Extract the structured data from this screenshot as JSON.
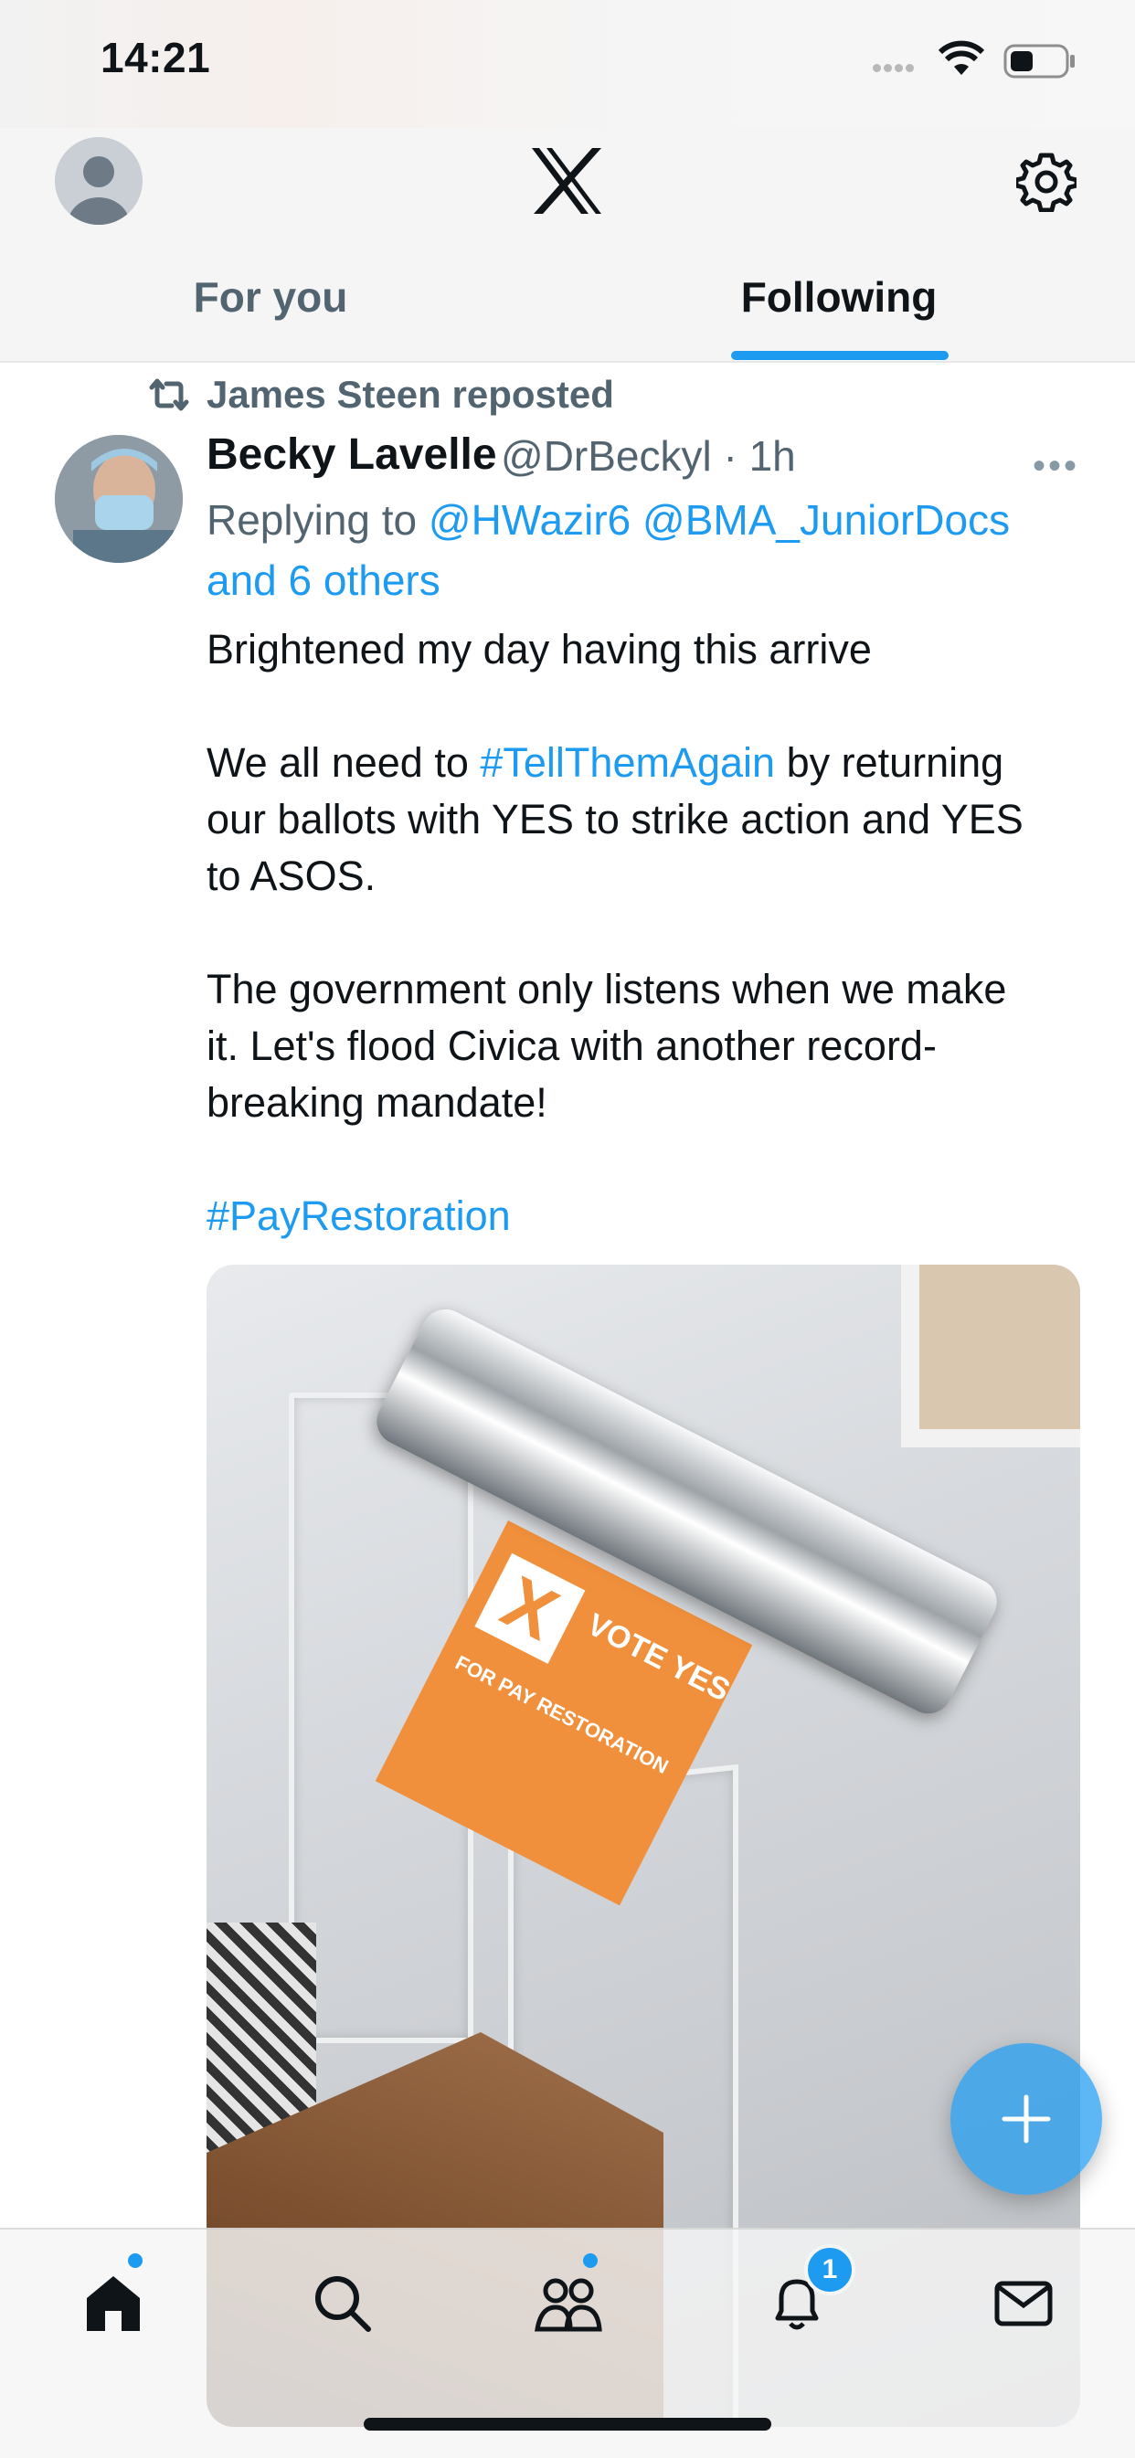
{
  "status_bar": {
    "time": "14:21"
  },
  "header": {
    "tabs": [
      {
        "label": "For you",
        "active": false
      },
      {
        "label": "Following",
        "active": true
      }
    ]
  },
  "tweet": {
    "repost_by": "James Steen reposted",
    "author_name": "Becky Lavelle",
    "author_handle": "@DrBeckyl · 1h",
    "replying_prefix": "Replying to",
    "replying_mentions": "@HWazir6 @BMA_JuniorDocs",
    "replying_others": "and 6 others",
    "line1": "Brightened my day having this arrive",
    "p2_before": "We all need to",
    "p2_hashtag": "#TellThemAgain",
    "p2_after_line1": "by returning",
    "p2_line2": "our ballots with YES to strike action and YES",
    "p2_line3": "to ASOS.",
    "p3_line1": "The government only listens when we make",
    "p3_line2": "it. Let's flood Civica with another record-",
    "p3_line3": "breaking mandate!",
    "hashtag_final": "#PayRestoration",
    "photo_text_1": "VOTE YES",
    "photo_text_2": "FOR PAY RESTORATION"
  },
  "nav": {
    "notifications_count": "1",
    "items": [
      "home-icon",
      "search-icon",
      "communities-icon",
      "notifications-icon",
      "messages-icon"
    ]
  },
  "colors": {
    "accent": "#1d9bf0",
    "text": "#0f1419",
    "secondary": "#536471"
  }
}
